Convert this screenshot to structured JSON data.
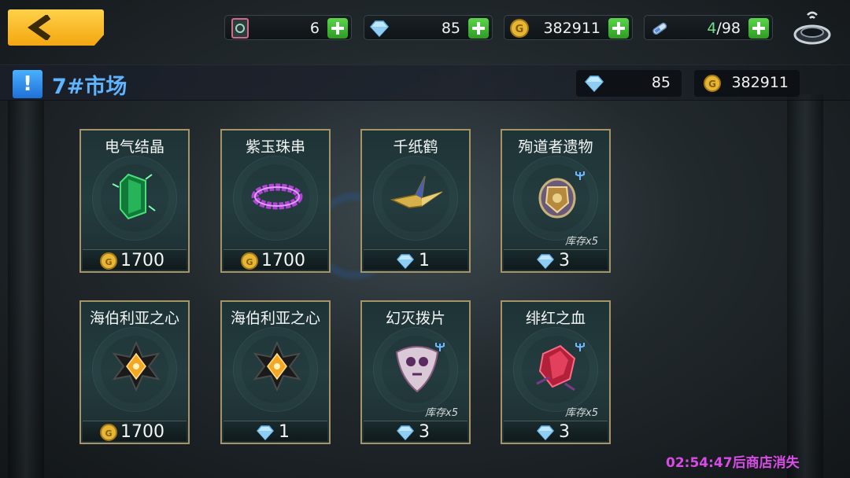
{
  "top_bar": {
    "tickets": "6",
    "gems": "85",
    "gold": "382911",
    "stamina_current": "4",
    "stamina_max": "/98"
  },
  "title": {
    "icon_text": "!",
    "text": "7#市场",
    "gems": "85",
    "gold": "382911"
  },
  "items": [
    {
      "name": "电气结晶",
      "price": "1700",
      "currency": "gold-coin-icon",
      "stock": ""
    },
    {
      "name": "紫玉珠串",
      "price": "1700",
      "currency": "gold-coin-icon",
      "stock": ""
    },
    {
      "name": "千纸鹤",
      "price": "1",
      "currency": "gem-icon",
      "stock": ""
    },
    {
      "name": "殉道者遗物",
      "price": "3",
      "currency": "gem-icon",
      "stock": "库存x5"
    },
    {
      "name": "海伯利亚之心",
      "price": "1700",
      "currency": "gold-coin-icon",
      "stock": ""
    },
    {
      "name": "海伯利亚之心",
      "price": "1",
      "currency": "gem-icon",
      "stock": ""
    },
    {
      "name": "幻灭拨片",
      "price": "3",
      "currency": "gem-icon",
      "stock": "库存x5"
    },
    {
      "name": "绯红之血",
      "price": "3",
      "currency": "gem-icon",
      "stock": "库存x5"
    }
  ],
  "timer": "02:54:47后商店消失",
  "colors": {
    "accent_gold": "#f3a611",
    "title_blue": "#5fb4ff",
    "timer_magenta": "#d94be6",
    "card_border": "#a69468",
    "plus_green": "#3cb82e"
  }
}
